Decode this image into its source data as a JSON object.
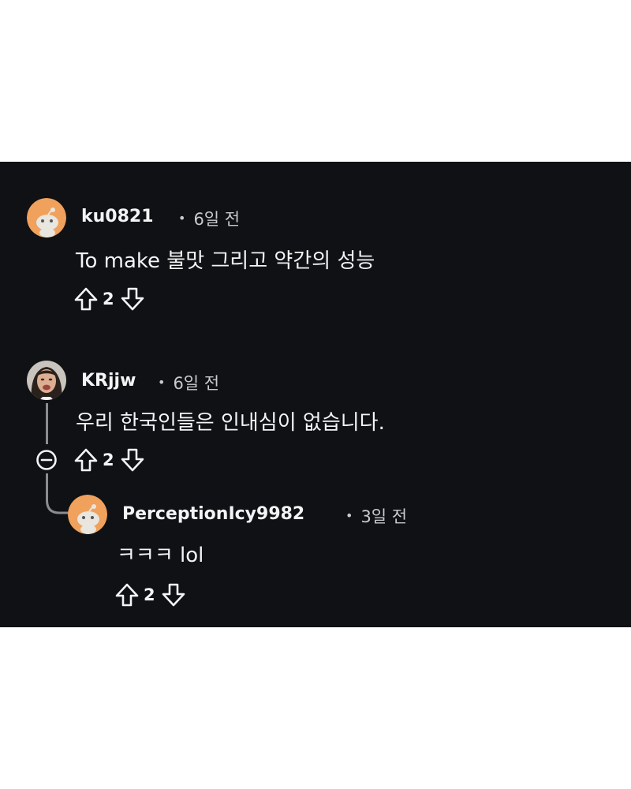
{
  "comments": [
    {
      "username": "ku0821",
      "time": "6일 전",
      "body": "To make 불맛 그리고 약간의 성능",
      "votes": "2",
      "avatar": "snoo-avatar-icon"
    },
    {
      "username": "KRjjw",
      "time": "6일 전",
      "body": "우리 한국인들은 인내심이 없습니다.",
      "votes": "2",
      "avatar": "profile-photo"
    },
    {
      "username": "PerceptionIcy9982",
      "time": "3일 전",
      "body": "ㅋㅋㅋ lol",
      "votes": "2",
      "avatar": "snoo-avatar-icon"
    }
  ],
  "colors": {
    "background": "#0f1114",
    "text": "#f2f4f5",
    "meta_text": "#c8cbcd",
    "avatar_orange": "#f0a15c",
    "thread_line": "#8a8d90"
  }
}
